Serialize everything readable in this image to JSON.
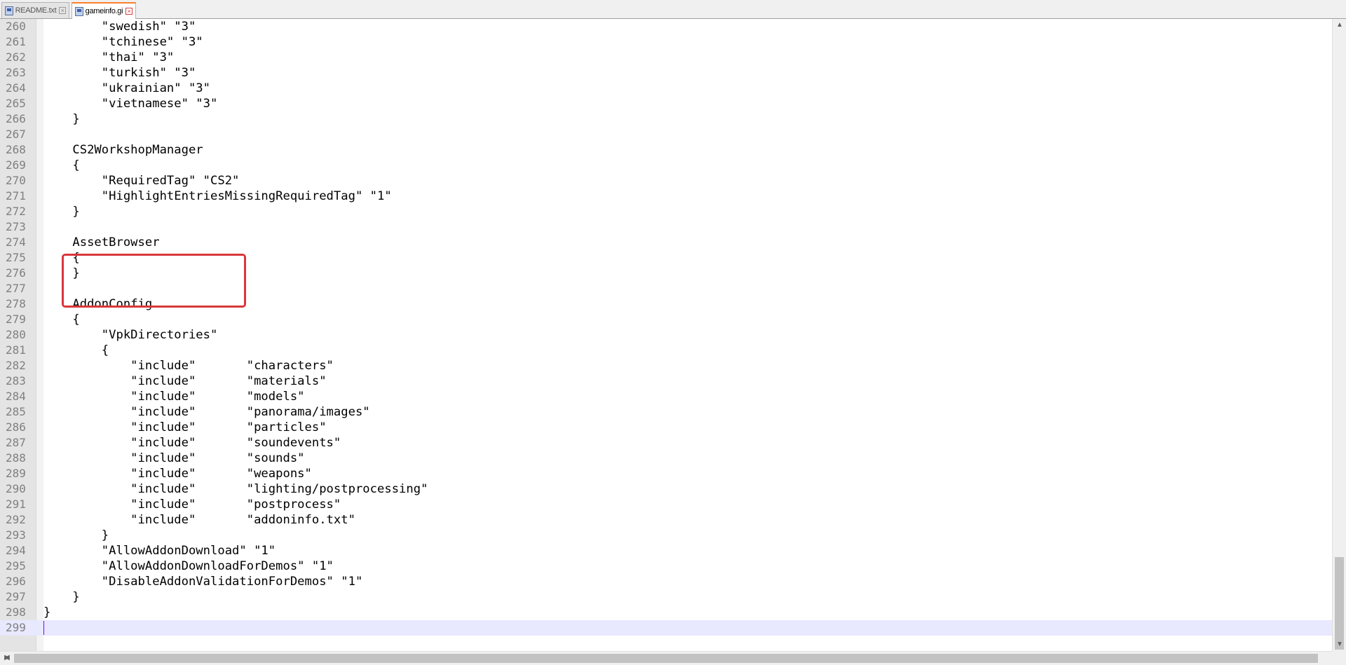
{
  "tabs": [
    {
      "label": "README.txt",
      "active": false,
      "icon": "document-icon"
    },
    {
      "label": "gameinfo.gi",
      "active": true,
      "icon": "document-icon"
    }
  ],
  "editor": {
    "current_line": 299,
    "highlight_lines": [
      274,
      276
    ],
    "lines": [
      {
        "num": "260",
        "text": "        \"swedish\" \"3\""
      },
      {
        "num": "261",
        "text": "        \"tchinese\" \"3\""
      },
      {
        "num": "262",
        "text": "        \"thai\" \"3\""
      },
      {
        "num": "263",
        "text": "        \"turkish\" \"3\""
      },
      {
        "num": "264",
        "text": "        \"ukrainian\" \"3\""
      },
      {
        "num": "265",
        "text": "        \"vietnamese\" \"3\""
      },
      {
        "num": "266",
        "text": "    }"
      },
      {
        "num": "267",
        "text": ""
      },
      {
        "num": "268",
        "text": "    CS2WorkshopManager"
      },
      {
        "num": "269",
        "text": "    {"
      },
      {
        "num": "270",
        "text": "        \"RequiredTag\" \"CS2\""
      },
      {
        "num": "271",
        "text": "        \"HighlightEntriesMissingRequiredTag\" \"1\""
      },
      {
        "num": "272",
        "text": "    }"
      },
      {
        "num": "273",
        "text": ""
      },
      {
        "num": "274",
        "text": "    AssetBrowser"
      },
      {
        "num": "275",
        "text": "    {"
      },
      {
        "num": "276",
        "text": "    }"
      },
      {
        "num": "277",
        "text": ""
      },
      {
        "num": "278",
        "text": "    AddonConfig"
      },
      {
        "num": "279",
        "text": "    {"
      },
      {
        "num": "280",
        "text": "        \"VpkDirectories\""
      },
      {
        "num": "281",
        "text": "        {"
      },
      {
        "num": "282",
        "text": "            \"include\"       \"characters\""
      },
      {
        "num": "283",
        "text": "            \"include\"       \"materials\""
      },
      {
        "num": "284",
        "text": "            \"include\"       \"models\""
      },
      {
        "num": "285",
        "text": "            \"include\"       \"panorama/images\""
      },
      {
        "num": "286",
        "text": "            \"include\"       \"particles\""
      },
      {
        "num": "287",
        "text": "            \"include\"       \"soundevents\""
      },
      {
        "num": "288",
        "text": "            \"include\"       \"sounds\""
      },
      {
        "num": "289",
        "text": "            \"include\"       \"weapons\""
      },
      {
        "num": "290",
        "text": "            \"include\"       \"lighting/postprocessing\""
      },
      {
        "num": "291",
        "text": "            \"include\"       \"postprocess\""
      },
      {
        "num": "292",
        "text": "            \"include\"       \"addoninfo.txt\""
      },
      {
        "num": "293",
        "text": "        }"
      },
      {
        "num": "294",
        "text": "        \"AllowAddonDownload\" \"1\""
      },
      {
        "num": "295",
        "text": "        \"AllowAddonDownloadForDemos\" \"1\""
      },
      {
        "num": "296",
        "text": "        \"DisableAddonValidationForDemos\" \"1\""
      },
      {
        "num": "297",
        "text": "    }"
      },
      {
        "num": "298",
        "text": "}"
      },
      {
        "num": "299",
        "text": ""
      }
    ]
  },
  "colors": {
    "highlight_box": "#d9373c",
    "current_line": "#e8e8ff",
    "active_tab_accent": "#fa7f2d"
  },
  "scrollbars": {
    "vertical_arrow_up": "▲",
    "vertical_arrow_down": "▼",
    "horizontal_arrow_left": "◀",
    "horizontal_arrow_right": "▶"
  }
}
